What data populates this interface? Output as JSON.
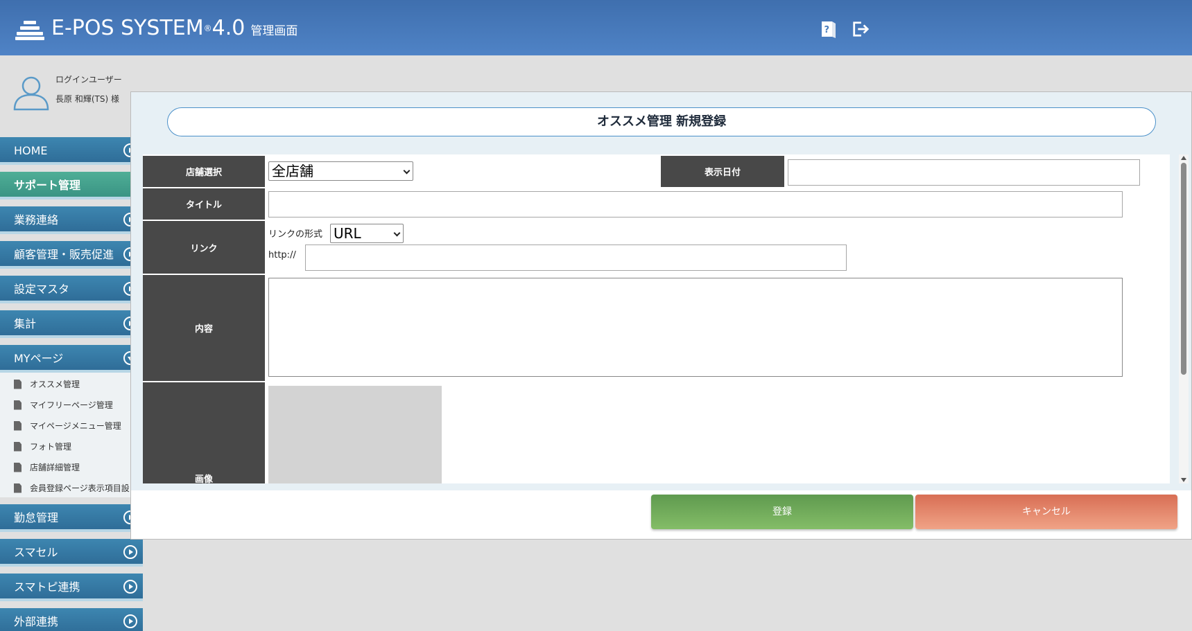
{
  "header": {
    "logo_text": "E-POS SYSTEM",
    "logo_reg": "®",
    "logo_version": "4.0",
    "logo_sub": "管理画面",
    "icons": [
      "help-book-icon",
      "logout-icon"
    ]
  },
  "user": {
    "label": "ログインユーザー",
    "name": "長原 和輝(TS) 様"
  },
  "sidebar": {
    "items": [
      {
        "label": "HOME"
      },
      {
        "label": "サポート管理"
      },
      {
        "label": "業務連絡"
      },
      {
        "label": "顧客管理・販売促進"
      },
      {
        "label": "設定マスタ"
      },
      {
        "label": "集計"
      },
      {
        "label": "MYページ"
      },
      {
        "label": "勤怠管理"
      },
      {
        "label": "スマセル"
      },
      {
        "label": "スマトピ連携"
      },
      {
        "label": "外部連携"
      }
    ],
    "subitems": [
      {
        "label": "オススメ管理"
      },
      {
        "label": "マイフリーページ管理"
      },
      {
        "label": "マイページメニュー管理"
      },
      {
        "label": "フォト管理"
      },
      {
        "label": "店舗詳細管理"
      },
      {
        "label": "会員登録ページ表示項目設"
      }
    ]
  },
  "modal": {
    "title": "オススメ管理 新規登録",
    "form": {
      "store_label": "店舗選択",
      "store_value": "全店舗",
      "date_label": "表示日付",
      "date_value": "",
      "title_label": "タイトル",
      "title_value": "",
      "link_label": "リンク",
      "link_format_label": "リンクの形式",
      "link_format_value": "URL",
      "link_prefix": "http://",
      "link_value": "",
      "content_label": "内容",
      "content_value": "",
      "image_label": "画像"
    },
    "buttons": {
      "submit": "登録",
      "cancel": "キャンセル"
    }
  },
  "colors": {
    "header": "#4a7dbd",
    "nav": "#3579a3",
    "nav_active": "#45a58e",
    "submit": "#6fa95a",
    "cancel": "#e3866a"
  }
}
